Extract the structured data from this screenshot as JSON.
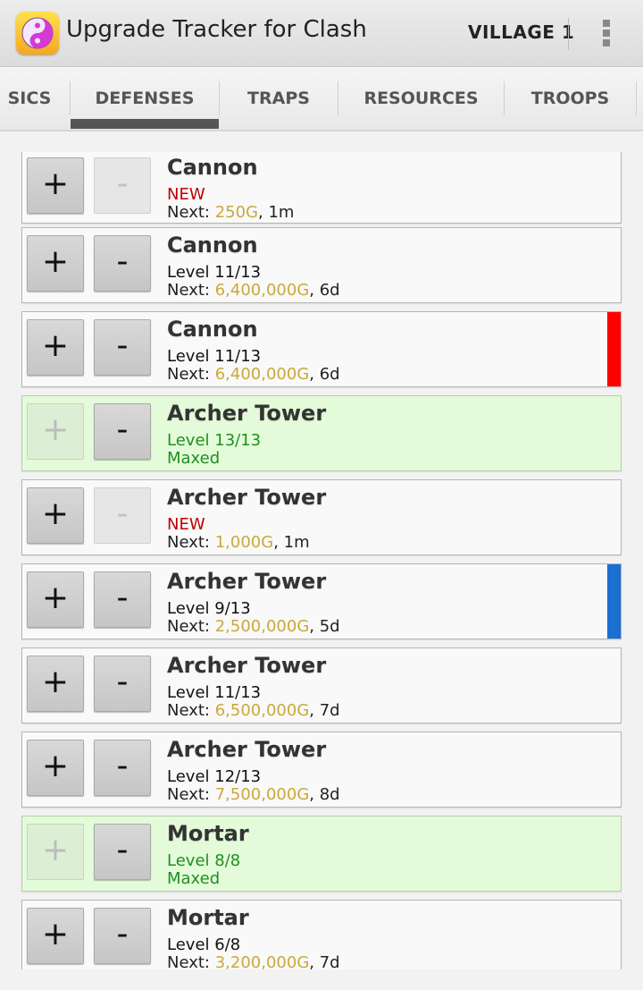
{
  "app": {
    "title": "Upgrade Tracker for Clash",
    "village": "VILLAGE 1",
    "icon": "yin-yang-icon",
    "menu_icon": "overflow-menu-icon"
  },
  "tabs": [
    {
      "label": "SICS",
      "selected": false
    },
    {
      "label": "DEFENSES",
      "selected": true
    },
    {
      "label": "TRAPS",
      "selected": false
    },
    {
      "label": "RESOURCES",
      "selected": false
    },
    {
      "label": "TROOPS",
      "selected": false
    }
  ],
  "buttons": {
    "plus": "+",
    "minus": "-"
  },
  "labels": {
    "next": "Next: ",
    "sep": ", "
  },
  "colors": {
    "gold": "#c9a93a",
    "new_red": "#c00000",
    "maxed_green": "#1f8f1f",
    "maxed_bg": "#e3fbd9",
    "marker_red": "#ff0000",
    "marker_blue": "#1a6fd1"
  },
  "items": [
    {
      "name": "Cannon",
      "status": "NEW",
      "next_cost": "250G",
      "next_time": "1m",
      "plus_enabled": true,
      "minus_enabled": false
    },
    {
      "name": "Cannon",
      "level": "Level 11/13",
      "next_cost": "6,400,000G",
      "next_time": "6d",
      "plus_enabled": true,
      "minus_enabled": true
    },
    {
      "name": "Cannon",
      "level": "Level 11/13",
      "next_cost": "6,400,000G",
      "next_time": "6d",
      "plus_enabled": true,
      "minus_enabled": true,
      "marker": "#ff0000"
    },
    {
      "name": "Archer Tower",
      "level": "Level 13/13",
      "maxed": "Maxed",
      "plus_enabled": false,
      "minus_enabled": true
    },
    {
      "name": "Archer Tower",
      "status": "NEW",
      "next_cost": "1,000G",
      "next_time": "1m",
      "plus_enabled": true,
      "minus_enabled": false
    },
    {
      "name": "Archer Tower",
      "level": "Level 9/13",
      "next_cost": "2,500,000G",
      "next_time": "5d",
      "plus_enabled": true,
      "minus_enabled": true,
      "marker": "#1a6fd1"
    },
    {
      "name": "Archer Tower",
      "level": "Level 11/13",
      "next_cost": "6,500,000G",
      "next_time": "7d",
      "plus_enabled": true,
      "minus_enabled": true
    },
    {
      "name": "Archer Tower",
      "level": "Level 12/13",
      "next_cost": "7,500,000G",
      "next_time": "8d",
      "plus_enabled": true,
      "minus_enabled": true
    },
    {
      "name": "Mortar",
      "level": "Level 8/8",
      "maxed": "Maxed",
      "plus_enabled": false,
      "minus_enabled": true
    },
    {
      "name": "Mortar",
      "level": "Level 6/8",
      "next_cost": "3,200,000G",
      "next_time": "7d",
      "plus_enabled": true,
      "minus_enabled": true
    }
  ]
}
